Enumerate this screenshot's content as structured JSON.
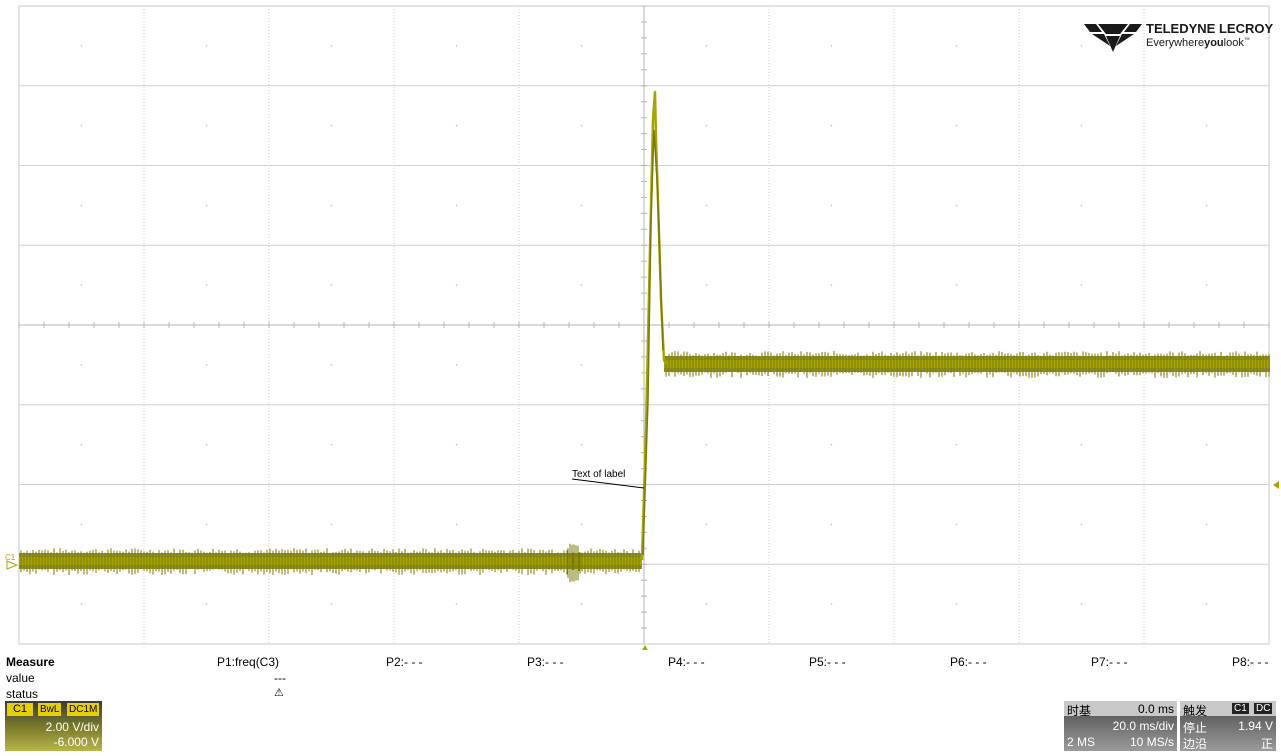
{
  "brand": {
    "name": "TELEDYNE LECROY",
    "tagline_parts": [
      "Everywhere",
      "you",
      "look",
      "™"
    ]
  },
  "scope": {
    "grid_cols": 10,
    "grid_rows": 8,
    "trace_color": "#a6a600",
    "trace_fill": "#7a7a00",
    "channel_marker": "C1",
    "label_text": "Text of label"
  },
  "measure": {
    "title": "Measure",
    "rows": [
      "value",
      "status"
    ],
    "params": [
      {
        "name": "P1:freq(C3)",
        "value": "---",
        "status": "⚠"
      },
      {
        "name": "P2:- - -"
      },
      {
        "name": "P3:- - -"
      },
      {
        "name": "P4:- - -"
      },
      {
        "name": "P5:- - -"
      },
      {
        "name": "P6:- - -"
      },
      {
        "name": "P7:- - -"
      },
      {
        "name": "P8:- - -"
      }
    ]
  },
  "channel": {
    "name": "C1",
    "tags": [
      "BwL",
      "DC1M"
    ],
    "vdiv": "2.00 V/div",
    "offset": "-6.000 V"
  },
  "timebase": {
    "title": "时基",
    "delay": "0.0 ms",
    "tdiv": "20.0 ms/div",
    "points": "2 MS",
    "rate": "10 MS/s"
  },
  "trigger": {
    "title": "触发",
    "source_tags": [
      "C1",
      "DC"
    ],
    "mode": "停止",
    "level": "1.94 V",
    "type": "边沿",
    "slope": "正"
  }
}
